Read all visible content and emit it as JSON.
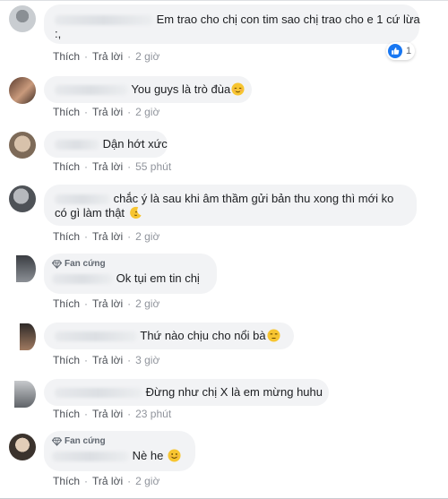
{
  "colors": {
    "bubble": "#f2f3f5",
    "link": "#4b4f56",
    "meta": "#90949c",
    "like": "#1877f2"
  },
  "comments": [
    {
      "text": "Em trao cho chị con tim sao chị trao cho e 1 cứ lừa",
      "text2": ":,",
      "actions": {
        "like": "Thích",
        "reply": "Trả lời",
        "time": "2 giờ"
      },
      "reaction": {
        "icon": "like-icon",
        "count": "1"
      }
    },
    {
      "name": "Ngoc",
      "text": "You guys là trò đùa",
      "emoji": "relieved-face-icon",
      "actions": {
        "like": "Thích",
        "reply": "Trả lời",
        "time": "2 giờ"
      }
    },
    {
      "name": "C",
      "text": "Dận hớt xức",
      "actions": {
        "like": "Thích",
        "reply": "Trả lời",
        "time": "55 phút"
      }
    },
    {
      "name": "S",
      "text": "chắc ý là sau khi âm thầm gửi bản thu xong thì mới ko",
      "text2": "có gì làm thật",
      "emoji": "crescent-moon-face-icon",
      "actions": {
        "like": "Thích",
        "reply": "Trả lời",
        "time": "2 giờ"
      }
    },
    {
      "badge": "Fan cứng",
      "name": "T",
      "text": "Ok tụi em tin chị",
      "actions": {
        "like": "Thích",
        "reply": "Trả lời",
        "time": "2 giờ"
      }
    },
    {
      "name": "T",
      "text": "Thứ nào chịu cho nổi bà",
      "emoji": "unamused-face-icon",
      "actions": {
        "like": "Thích",
        "reply": "Trả lời",
        "time": "3 giờ"
      }
    },
    {
      "name": "Thái Khang",
      "text": "Đừng như chị X là em mừng huhu",
      "actions": {
        "like": "Thích",
        "reply": "Trả lời",
        "time": "23 phút"
      }
    },
    {
      "badge": "Fan cứng",
      "name": "C",
      "text": "Nè he",
      "emoji": "smiling-face-icon",
      "actions": {
        "like": "Thích",
        "reply": "Trả lời",
        "time": "2 giờ"
      }
    }
  ]
}
